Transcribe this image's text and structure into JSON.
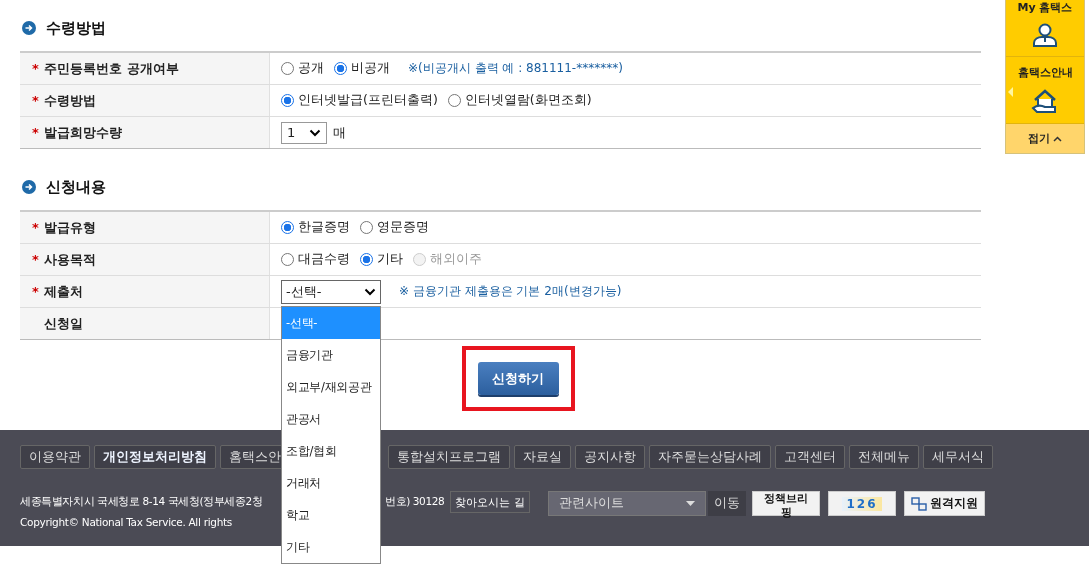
{
  "sections": [
    {
      "title": "수령방법",
      "rows": [
        {
          "label": "주민등록번호 공개여부",
          "mark": "*",
          "kind": "radio",
          "options": [
            {
              "label": "공개",
              "selected": false,
              "disabled": false
            },
            {
              "label": "비공개",
              "selected": true,
              "disabled": false
            }
          ],
          "note": "※(비공개시 출력 예 : 881111-*******)"
        },
        {
          "label": "수령방법",
          "mark": "*",
          "kind": "radio",
          "options": [
            {
              "label": "인터넷발급(프린터출력)",
              "selected": true,
              "disabled": false
            },
            {
              "label": "인터넷열람(화면조회)",
              "selected": false,
              "disabled": false
            }
          ]
        },
        {
          "label": "발급희망수량",
          "mark": "*",
          "kind": "quantity",
          "value": "1",
          "unit": "매"
        }
      ]
    },
    {
      "title": "신청내용",
      "rows": [
        {
          "label": "발급유형",
          "mark": "*",
          "kind": "radio",
          "options": [
            {
              "label": "한글증명",
              "selected": true,
              "disabled": false
            },
            {
              "label": "영문증명",
              "selected": false,
              "disabled": false
            }
          ]
        },
        {
          "label": "사용목적",
          "mark": "*",
          "kind": "radio",
          "options": [
            {
              "label": "대금수령",
              "selected": false,
              "disabled": false
            },
            {
              "label": "기타",
              "selected": true,
              "disabled": false
            },
            {
              "label": "해외이주",
              "selected": false,
              "disabled": true
            }
          ]
        },
        {
          "label": "제출처",
          "mark": "*",
          "kind": "dropdown",
          "value": "-선택-",
          "expanded": true,
          "note": "※ 금융기관 제출용은 기본 2매(변경가능)",
          "options": [
            {
              "label": "-선택-",
              "selected": true
            },
            {
              "label": "금융기관",
              "selected": false
            },
            {
              "label": "외교부/재외공관",
              "selected": false
            },
            {
              "label": "관공서",
              "selected": false
            },
            {
              "label": "조합/협회",
              "selected": false
            },
            {
              "label": "거래처",
              "selected": false
            },
            {
              "label": "학교",
              "selected": false
            },
            {
              "label": "기타",
              "selected": false
            }
          ]
        },
        {
          "label": "신청일",
          "kind": "empty"
        }
      ]
    }
  ],
  "submit": {
    "label": "신청하기",
    "highlighted": true
  },
  "side_panel": {
    "items": [
      {
        "label": "My 홈택스",
        "kind": "user"
      },
      {
        "label": "홈택스안내",
        "kind": "house"
      }
    ],
    "collapse": "접기"
  },
  "footer": {
    "link_groups": [
      [
        {
          "label": "이용약관",
          "bold": false
        },
        {
          "label": "개인정보처리방침",
          "bold": true
        },
        {
          "label": "홈택스안",
          "bold": false
        }
      ],
      [
        {
          "label": "통합설치프로그램",
          "bold": false
        },
        {
          "label": "자료실",
          "bold": false
        },
        {
          "label": "공지사항",
          "bold": false
        },
        {
          "label": "자주묻는상담사례",
          "bold": false
        },
        {
          "label": "고객센터",
          "bold": false
        },
        {
          "label": "전체메뉴",
          "bold": false
        },
        {
          "label": "세무서식",
          "bold": false
        }
      ]
    ],
    "address_parts": [
      "세종특별자치시 국세청로 8-14 국세청(정부세종2청",
      "번호) 30128"
    ],
    "directions": "찾아오시는 길",
    "copyright": "Copyright© National Tax Service. All rights",
    "related_sites": "관련사이트",
    "go": "이동",
    "banners": [
      {
        "kind": "briefing",
        "label": "정책브리핑"
      },
      {
        "kind": "callcenter",
        "label": "126"
      },
      {
        "kind": "remote",
        "label": "원격지원"
      }
    ]
  }
}
